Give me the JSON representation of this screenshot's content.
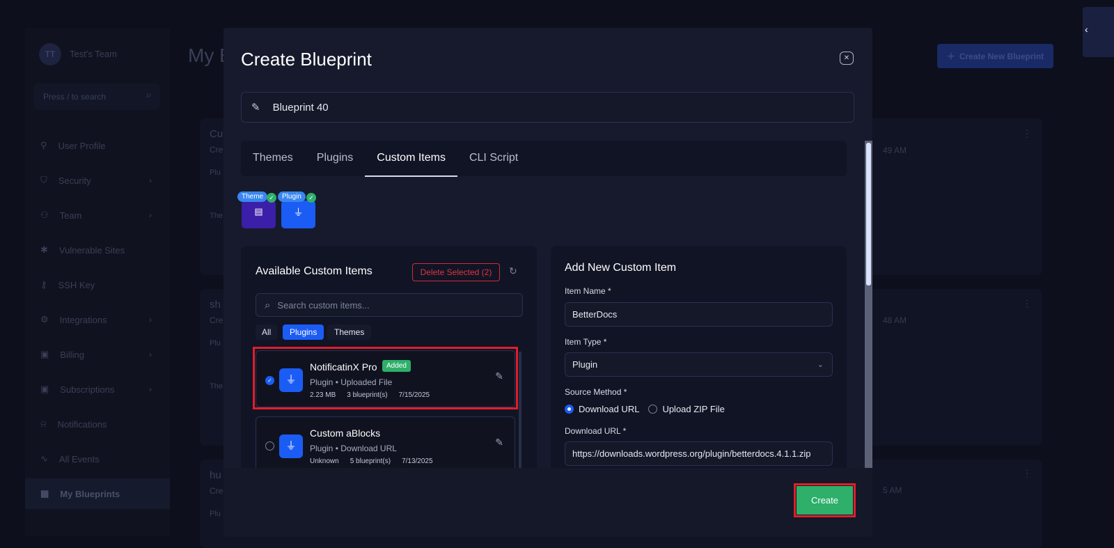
{
  "sidebar": {
    "team_initials": "TT",
    "team_name": "Test's Team",
    "search_placeholder": "Press / to search",
    "items": [
      {
        "label": "User Profile",
        "icon": "user-icon"
      },
      {
        "label": "Security",
        "icon": "shield-icon",
        "chev": true
      },
      {
        "label": "Team",
        "icon": "team-icon",
        "chev": true
      },
      {
        "label": "Vulnerable Sites",
        "icon": "bug-icon"
      },
      {
        "label": "SSH Key",
        "icon": "key-icon"
      },
      {
        "label": "Integrations",
        "icon": "gear-icon",
        "chev": true
      },
      {
        "label": "Billing",
        "icon": "billing-icon",
        "chev": true
      },
      {
        "label": "Subscriptions",
        "icon": "subscription-icon",
        "chev": true
      },
      {
        "label": "Notifications",
        "icon": "bell-icon"
      },
      {
        "label": "All Events",
        "icon": "activity-icon"
      },
      {
        "label": "My Blueprints",
        "icon": "blueprint-icon",
        "active": true
      }
    ]
  },
  "page": {
    "title": "My B",
    "create_button": "Create New Blueprint",
    "cards": [
      {
        "title": "Cu",
        "sub": "Cre",
        "plugins": "Plu",
        "themes": "The",
        "time": "49 AM"
      },
      {
        "title": "sh",
        "sub": "Cre",
        "plugins": "Plu",
        "themes": "The",
        "time": "48 AM"
      },
      {
        "title": "hu",
        "sub": "Cre",
        "plugins": "Plu",
        "time": "5 AM"
      }
    ]
  },
  "modal": {
    "title": "Create Blueprint",
    "name_value": "Blueprint 40",
    "tabs": [
      "Themes",
      "Plugins",
      "Custom Items",
      "CLI Script"
    ],
    "active_tab": "Custom Items",
    "selected_badges": [
      {
        "label": "Theme",
        "color": "#3b1fa8"
      },
      {
        "label": "Plugin",
        "color": "#1b5cf5"
      }
    ],
    "available": {
      "title": "Available Custom Items",
      "delete_button": "Delete Selected (2)",
      "search_placeholder": "Search custom items...",
      "filters": [
        "All",
        "Plugins",
        "Themes"
      ],
      "active_filter": "Plugins",
      "items": [
        {
          "name": "NotificatinX Pro",
          "badge": "Added",
          "sub": "Plugin • Uploaded File",
          "size": "2.23 MB",
          "blueprints": "3 blueprint(s)",
          "date": "7/15/2025",
          "checked": true
        },
        {
          "name": "Custom aBlocks",
          "sub": "Plugin • Download URL",
          "size": "Unknown",
          "blueprints": "5 blueprint(s)",
          "date": "7/13/2025",
          "checked": false
        }
      ]
    },
    "form": {
      "title": "Add New Custom Item",
      "item_name_label": "Item Name *",
      "item_name_value": "BetterDocs",
      "item_type_label": "Item Type *",
      "item_type_value": "Plugin",
      "source_label": "Source Method *",
      "source_options": [
        "Download URL",
        "Upload ZIP File"
      ],
      "source_selected": "Download URL",
      "url_label": "Download URL *",
      "url_value": "https://downloads.wordpress.org/plugin/betterdocs.4.1.1.zip"
    },
    "create_button": "Create"
  },
  "colors": {
    "accent": "#1b5cf5",
    "success": "#2eaf6a",
    "danger": "#e11d2a"
  }
}
